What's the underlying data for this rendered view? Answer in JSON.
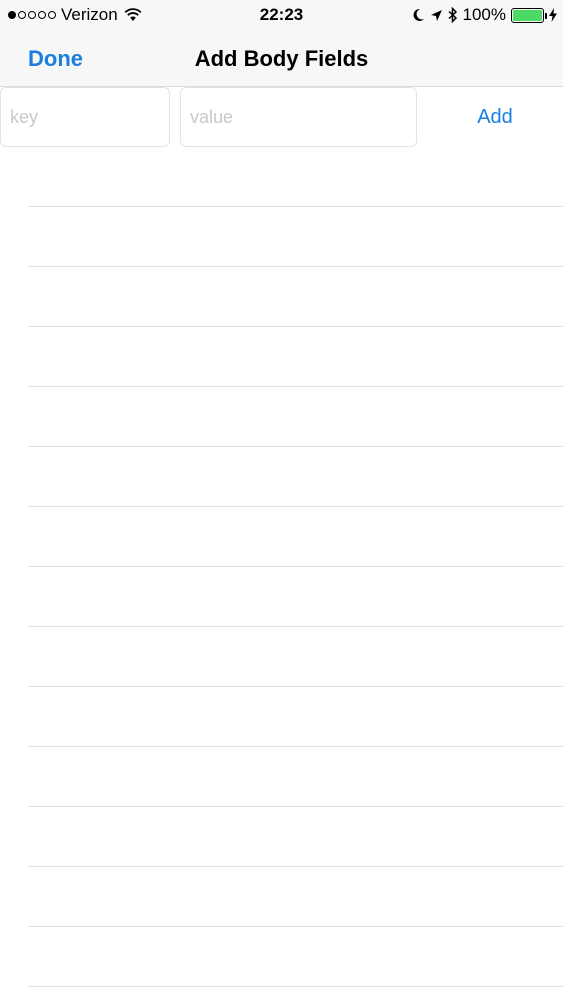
{
  "status_bar": {
    "carrier": "Verizon",
    "signal_bars_filled": 1,
    "signal_bars_total": 5,
    "time": "22:23",
    "battery_percent": "100%",
    "battery_level": 1.0,
    "icons": [
      "wifi-icon",
      "moon-icon",
      "location-arrow-icon",
      "bluetooth-icon",
      "battery-icon",
      "charging-bolt-icon"
    ],
    "battery_color": "#4cd964"
  },
  "nav": {
    "done_label": "Done",
    "title": "Add Body Fields"
  },
  "form": {
    "key_placeholder": "key",
    "key_value": "",
    "value_placeholder": "value",
    "value_value": "",
    "add_label": "Add"
  },
  "table": {
    "rows": []
  },
  "colors": {
    "accent": "#1a7fe0",
    "bar_background": "#f7f7f7",
    "separator": "#e0e0e0"
  }
}
